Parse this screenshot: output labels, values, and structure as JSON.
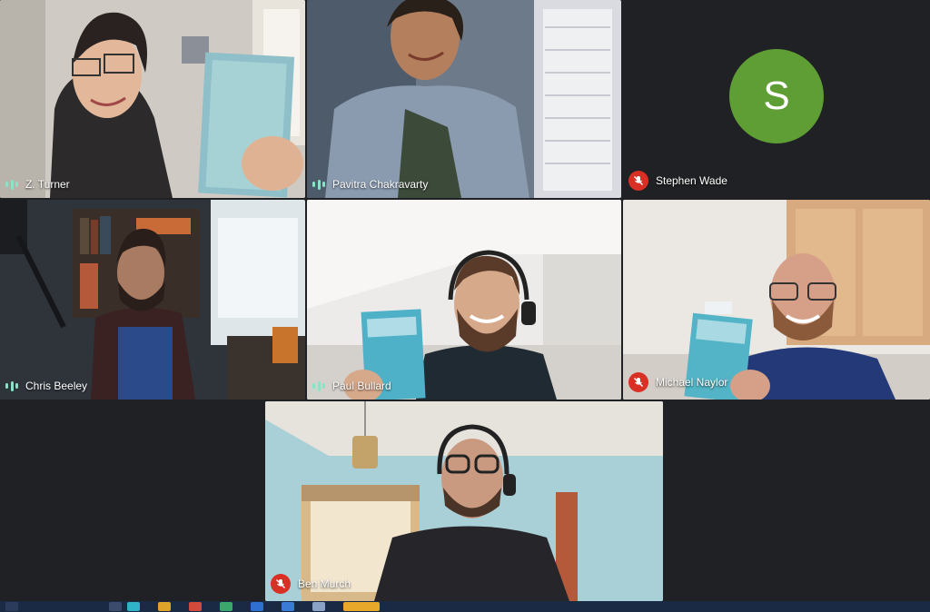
{
  "participants": [
    {
      "name": "Z. Turner",
      "mic": "on"
    },
    {
      "name": "Pavitra Chakravarty",
      "mic": "on"
    },
    {
      "name": "Stephen Wade",
      "mic": "off",
      "avatar_letter": "S",
      "avatar_color": "#5f9e34"
    },
    {
      "name": "Chris Beeley",
      "mic": "on"
    },
    {
      "name": "Paul Bullard",
      "mic": "on"
    },
    {
      "name": "Michael Naylor",
      "mic": "off"
    },
    {
      "name": "Ben Murch",
      "mic": "off"
    }
  ],
  "colors": {
    "background": "#202124",
    "mic_off": "#d93025",
    "mic_on": "#8ae3c7",
    "taskbar": "#1b2a44"
  },
  "icons": {
    "mic_on": "audio-level-icon",
    "mic_off": "mic-muted-icon"
  }
}
